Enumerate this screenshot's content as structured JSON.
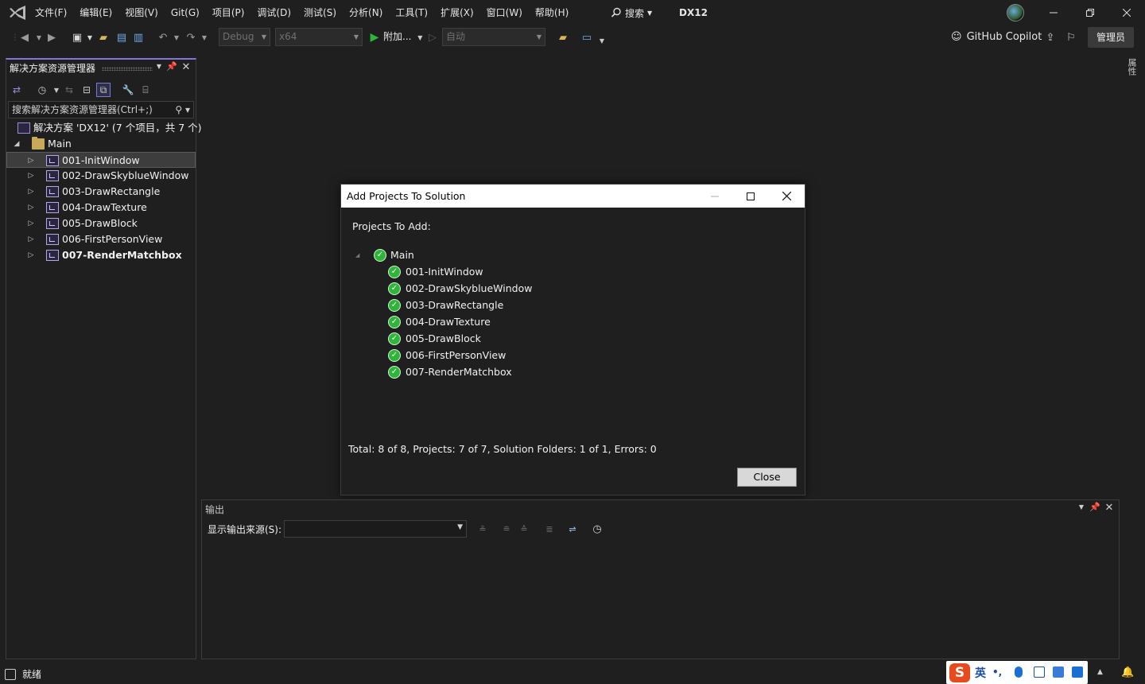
{
  "titlebar": {
    "menu": [
      "文件(F)",
      "编辑(E)",
      "视图(V)",
      "Git(G)",
      "项目(P)",
      "调试(D)",
      "测试(S)",
      "分析(N)",
      "工具(T)",
      "扩展(X)",
      "窗口(W)",
      "帮助(H)"
    ],
    "search_label": "搜索",
    "solution_name": "DX12"
  },
  "toolbar": {
    "config": "Debug",
    "platform": "x64",
    "attach_label": "附加...",
    "auto_combo": "自动",
    "copilot_label": "GitHub Copilot",
    "admin_label": "管理员"
  },
  "solution_explorer": {
    "title": "解决方案资源管理器",
    "search_placeholder": "搜索解决方案资源管理器(Ctrl+;)",
    "solution_node": "解决方案 'DX12' (7 个项目，共 7 个)",
    "folder_node": "Main",
    "projects": [
      {
        "name": "001-InitWindow",
        "selected": true,
        "bold": false
      },
      {
        "name": "002-DrawSkyblueWindow",
        "selected": false,
        "bold": false
      },
      {
        "name": "003-DrawRectangle",
        "selected": false,
        "bold": false
      },
      {
        "name": "004-DrawTexture",
        "selected": false,
        "bold": false
      },
      {
        "name": "005-DrawBlock",
        "selected": false,
        "bold": false
      },
      {
        "name": "006-FirstPersonView",
        "selected": false,
        "bold": false
      },
      {
        "name": "007-RenderMatchbox",
        "selected": false,
        "bold": true
      }
    ]
  },
  "right_rail": {
    "label": "属性"
  },
  "dialog": {
    "title": "Add Projects To Solution",
    "heading": "Projects To Add:",
    "root": "Main",
    "items": [
      "001-InitWindow",
      "002-DrawSkyblueWindow",
      "003-DrawRectangle",
      "004-DrawTexture",
      "005-DrawBlock",
      "006-FirstPersonView",
      "007-RenderMatchbox"
    ],
    "summary": "Total: 8 of 8, Projects: 7 of 7, Solution Folders: 1 of 1, Errors: 0",
    "close_label": "Close"
  },
  "output": {
    "title": "输出",
    "source_label": "显示输出来源(S):",
    "source_value": ""
  },
  "statusbar": {
    "text": "就绪",
    "ime_logo": "S",
    "ime_lang": "英"
  },
  "colors": {
    "accent": "#8076d9",
    "check": "#2fb53a",
    "run": "#2fb53a",
    "ime_logo": "#e84a1e"
  }
}
